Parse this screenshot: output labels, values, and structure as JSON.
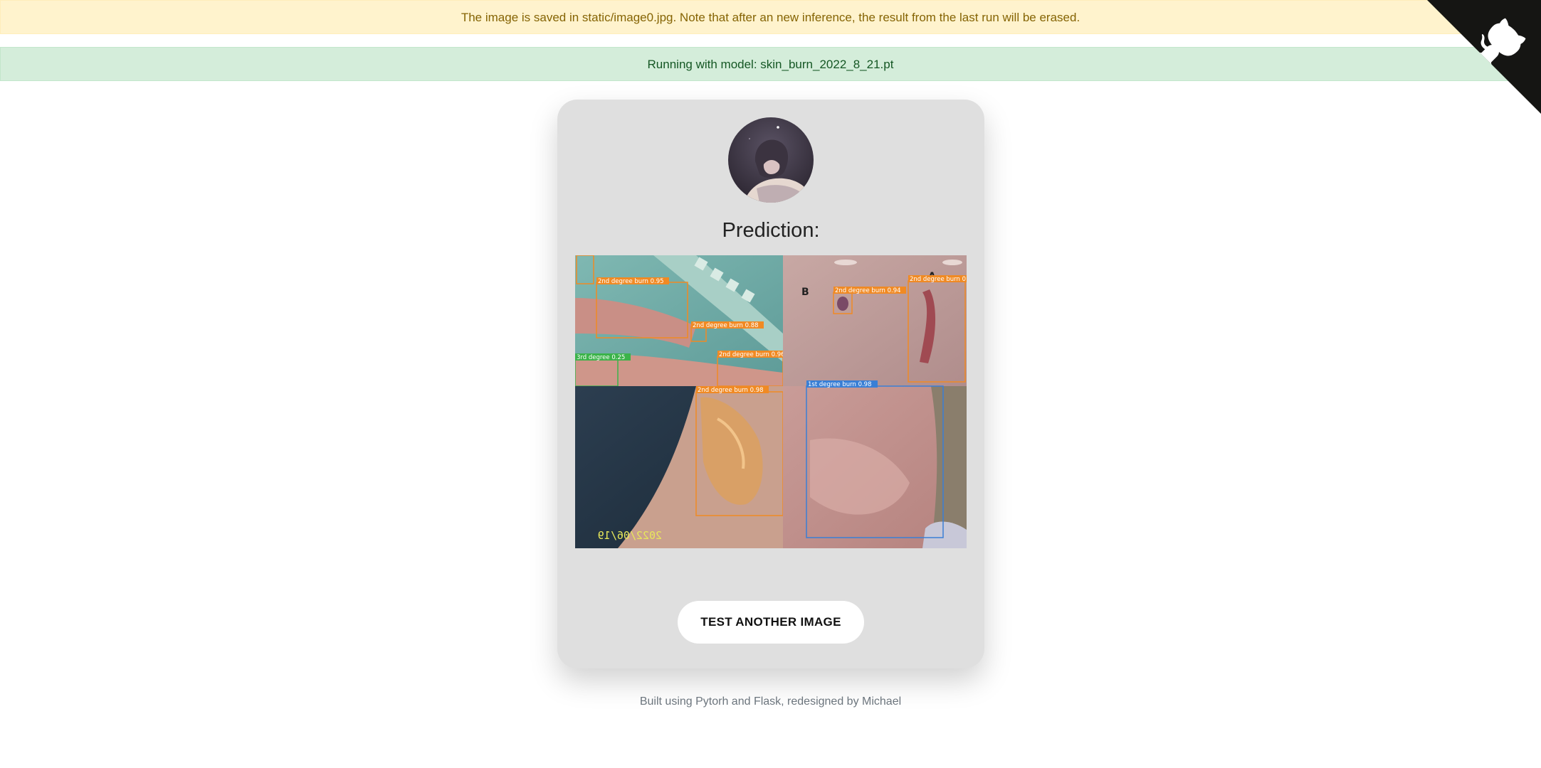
{
  "alerts": {
    "warning": "The image is saved in static/image0.jpg. Note that after an new inference, the result from the last run will be erased.",
    "success": "Running with model: skin_burn_2022_8_21.pt"
  },
  "card": {
    "title": "Prediction:",
    "button_label": "TEST ANOTHER IMAGE"
  },
  "detections": [
    {
      "label": "2nd degree burn 0.95",
      "color": "#f08a24"
    },
    {
      "label": "2nd degree burn 0.88",
      "color": "#f08a24"
    },
    {
      "label": "2nd degree burn 0.96",
      "color": "#f08a24"
    },
    {
      "label": "3rd degree 0.25",
      "color": "#3bb34a"
    },
    {
      "label": "2nd degree burn 0.98",
      "color": "#f08a24"
    },
    {
      "label": "2nd degree burn 0.94",
      "color": "#f08a24"
    },
    {
      "label": "2nd degree burn 0",
      "color": "#f08a24"
    },
    {
      "label": "1st degree burn 0.98",
      "color": "#3a7fd5"
    }
  ],
  "photo_markings": {
    "date_stamp": "2022/06/19",
    "skin_letters": [
      "B",
      "A"
    ]
  },
  "footer": "Built using Pytorh and Flask, redesigned by Michael",
  "icons": {
    "corner": "github-octocat-icon",
    "avatar": "profile-avatar"
  }
}
